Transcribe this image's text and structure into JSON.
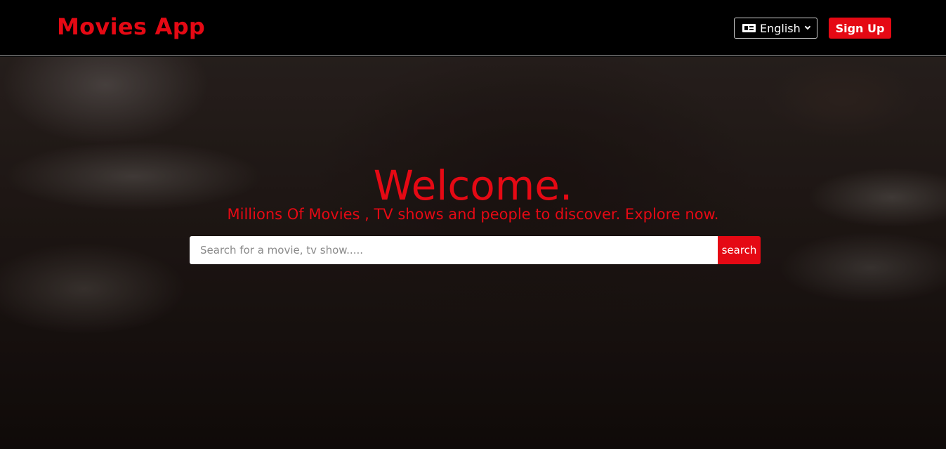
{
  "navbar": {
    "brand": "Movies App",
    "language": {
      "selected": "English",
      "icon": "language-icon"
    },
    "signup_label": "Sign Up"
  },
  "hero": {
    "welcome": "Welcome.",
    "subtitle": "Millions Of Movies , TV shows and people to discover. Explore now.",
    "search": {
      "placeholder": "Search for a movie, tv show.....",
      "value": "",
      "button_label": "search"
    }
  },
  "colors": {
    "accent": "#e50914",
    "navbar_bg": "#000000",
    "text_light": "#ffffff"
  }
}
